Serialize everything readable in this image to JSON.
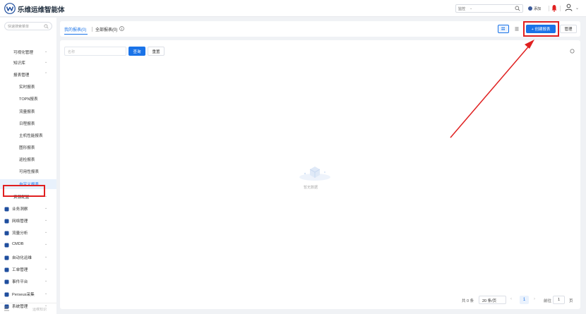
{
  "header": {
    "title": "乐维运维智能体",
    "search_scope": "监控",
    "add_label": "添加",
    "icons": {
      "logo": "lewei-logo",
      "search": "search-icon",
      "bell": "bell-icon",
      "user": "user-icon"
    },
    "alert_color": "#e02020"
  },
  "sidebar": {
    "search_placeholder": "快速搜索菜单",
    "items": [
      {
        "label": "可视化管理",
        "level": 1,
        "expanded": false
      },
      {
        "label": "知识库",
        "level": 1,
        "expanded": false
      },
      {
        "label": "报表管理",
        "level": 1,
        "expanded": true
      },
      {
        "label": "实时报表",
        "level": 2
      },
      {
        "label": "TOPN报表",
        "level": 2
      },
      {
        "label": "流量报表",
        "level": 2
      },
      {
        "label": "日程报表",
        "level": 2
      },
      {
        "label": "主机性能报表",
        "level": 2
      },
      {
        "label": "图形报表",
        "level": 2
      },
      {
        "label": "巡检报表",
        "level": 2
      },
      {
        "label": "可用性报表",
        "level": 2
      },
      {
        "label": "自定义报表",
        "level": 2,
        "active": true
      },
      {
        "label": "资源配置",
        "level": 1,
        "expanded": false
      },
      {
        "label": "业务洞察",
        "level": 0,
        "icon": "business-icon"
      },
      {
        "label": "网络管理",
        "level": 0,
        "icon": "network-icon"
      },
      {
        "label": "流量分析",
        "level": 0,
        "icon": "traffic-icon"
      },
      {
        "label": "CMDB",
        "level": 0,
        "icon": "cmdb-icon"
      },
      {
        "label": "自动化运维",
        "level": 0,
        "icon": "automation-icon"
      },
      {
        "label": "工单管理",
        "level": 0,
        "icon": "ticket-icon"
      },
      {
        "label": "事件平台",
        "level": 0,
        "icon": "event-icon"
      },
      {
        "label": "Perseus采集",
        "level": 0,
        "icon": "perseus-icon"
      },
      {
        "label": "系统管理",
        "level": 0,
        "icon": "settings-icon"
      }
    ],
    "footer_label": "运维知识"
  },
  "tabs": {
    "mine": "我的报表(0)",
    "all": "全部报表(0)"
  },
  "toolbar": {
    "create_label": "+ 创建报表",
    "manage_label": "管理"
  },
  "filter": {
    "name_placeholder": "名称",
    "query_label": "查询",
    "reset_label": "重置"
  },
  "empty_text": "暂无数据",
  "pagination": {
    "total": "共 0 条",
    "page_size": "20 条/页",
    "current": "1",
    "goto_label": "前往",
    "goto_value": "1",
    "page_unit": "页"
  },
  "colors": {
    "accent": "#1a73e8",
    "highlight": "#e02020"
  }
}
